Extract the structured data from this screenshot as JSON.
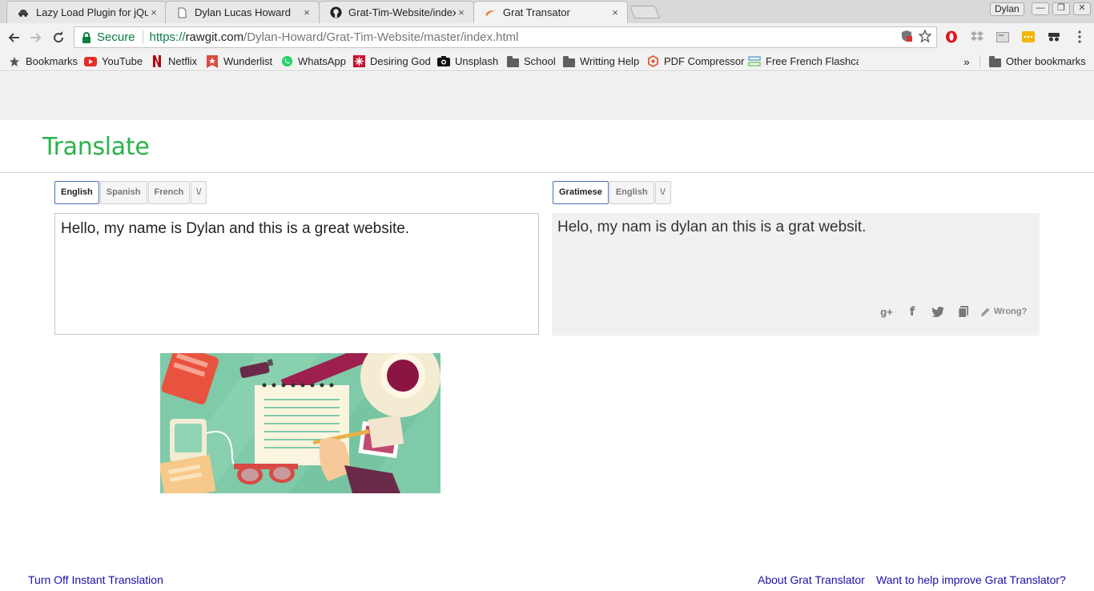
{
  "browser": {
    "tabs": [
      {
        "title": "Lazy Load Plugin for jQu",
        "icon": "car-icon"
      },
      {
        "title": "Dylan Lucas Howard",
        "icon": "document-icon"
      },
      {
        "title": "Grat-Tim-Website/index",
        "icon": "github-icon"
      },
      {
        "title": "Grat Transator",
        "icon": "swoosh-icon"
      }
    ],
    "close_glyph": "×",
    "profile_name": "Dylan",
    "window_controls": {
      "minimize": "—",
      "restore": "❐",
      "close": "✕"
    },
    "secure_label": "Secure",
    "url": {
      "scheme": "https://",
      "host": "rawgit.com",
      "path": "/Dylan-Howard/Grat-Tim-Website/master/index.html"
    },
    "bookmarks": [
      {
        "label": "Bookmarks",
        "icon": "star-icon"
      },
      {
        "label": "YouTube",
        "icon": "youtube-icon"
      },
      {
        "label": "Netflix",
        "icon": "netflix-icon"
      },
      {
        "label": "Wunderlist",
        "icon": "wunderlist-icon"
      },
      {
        "label": "WhatsApp",
        "icon": "whatsapp-icon"
      },
      {
        "label": "Desiring God",
        "icon": "desiring-god-icon"
      },
      {
        "label": "Unsplash",
        "icon": "camera-icon"
      },
      {
        "label": "School",
        "icon": "folder-icon"
      },
      {
        "label": "Writting Help",
        "icon": "folder-icon"
      },
      {
        "label": "PDF Compressor",
        "icon": "pdf-compressor-icon"
      },
      {
        "label": "Free French Flashcar",
        "icon": "flashcard-icon"
      }
    ],
    "overflow_glyph": "»",
    "other_bookmarks": "Other bookmarks"
  },
  "page": {
    "title": "Translate",
    "source_languages": [
      "English",
      "Spanish",
      "French"
    ],
    "target_languages": [
      "Gratimese",
      "English"
    ],
    "dropdown_glyph": "\\/",
    "source_text": "Hello, my name is Dylan and this is a great website.",
    "translated_text": "Helo, my nam is dylan an this is a grat websit.",
    "tools": {
      "gplus": "g+",
      "facebook": "f",
      "wrong": "Wrong?"
    },
    "footer": {
      "left": "Turn Off Instant Translation",
      "right1": "About Grat Translator",
      "right2": "Want to help improve Grat Translator?"
    }
  },
  "colors": {
    "accent": "#2ab34a",
    "link": "#1a0dab",
    "secure": "#0b8043",
    "selected_border": "#4d6fb7"
  }
}
